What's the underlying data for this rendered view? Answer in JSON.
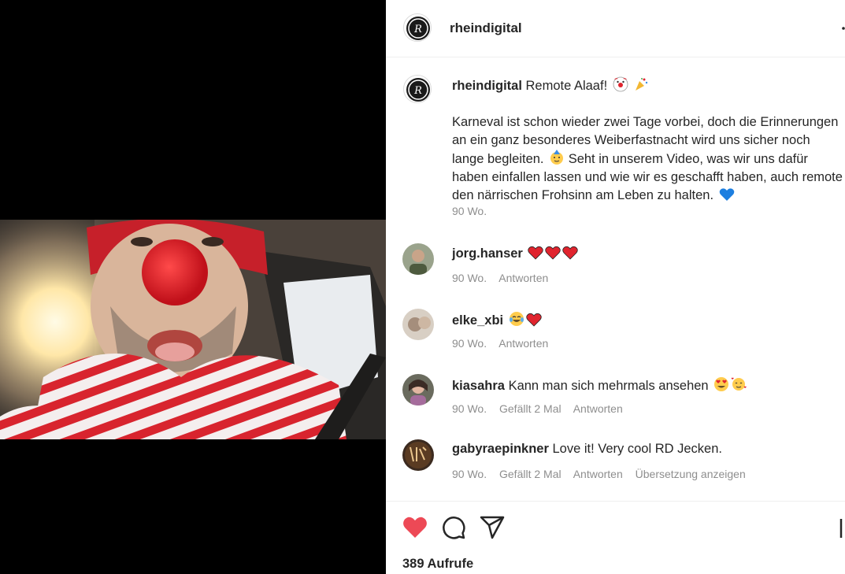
{
  "post": {
    "author": "rheindigital",
    "caption_title": "Remote Alaaf!",
    "caption_body": "Karneval ist schon wieder zwei Tage vorbei, doch die Erinnerungen an ein ganz besonderes Weiberfastnacht wird uns sicher noch lange begleiten.",
    "caption_body2": "Seht in unserem Video, was wir uns dafür haben einfallen lassen und wie wir es geschafft haben, auch remote den närrischen Frohsinn am Leben zu halten.",
    "caption_time": "90 Wo."
  },
  "comments": [
    {
      "username": "jorg.hanser",
      "text": "",
      "emojis": [
        "red-heart",
        "red-heart",
        "red-heart"
      ],
      "time": "90 Wo.",
      "likes": "",
      "reply": "Antworten",
      "translate": ""
    },
    {
      "username": "elke_xbi",
      "text": "",
      "emojis": [
        "tears-of-joy",
        "red-heart"
      ],
      "time": "90 Wo.",
      "likes": "",
      "reply": "Antworten",
      "translate": ""
    },
    {
      "username": "kiasahra",
      "text": "Kann man sich mehrmals ansehen",
      "emojis": [
        "heart-eyes",
        "smiling-hearts"
      ],
      "time": "90 Wo.",
      "likes": "Gefällt 2 Mal",
      "reply": "Antworten",
      "translate": ""
    },
    {
      "username": "gabyraepinkner",
      "text": "Love it! Very cool RD Jecken.",
      "emojis": [],
      "time": "90 Wo.",
      "likes": "Gefällt 2 Mal",
      "reply": "Antworten",
      "translate": "Übersetzung anzeigen"
    }
  ],
  "footer": {
    "views": "389 Aufrufe"
  },
  "colors": {
    "like_red": "#ed4956",
    "muted_text": "#8e8e8e",
    "primary_text": "#262626"
  },
  "icons": {
    "like": "heart-filled-icon",
    "comment": "comment-bubble-icon",
    "share": "paper-plane-icon",
    "save": "bookmark-icon",
    "more": "more-options-icon"
  }
}
